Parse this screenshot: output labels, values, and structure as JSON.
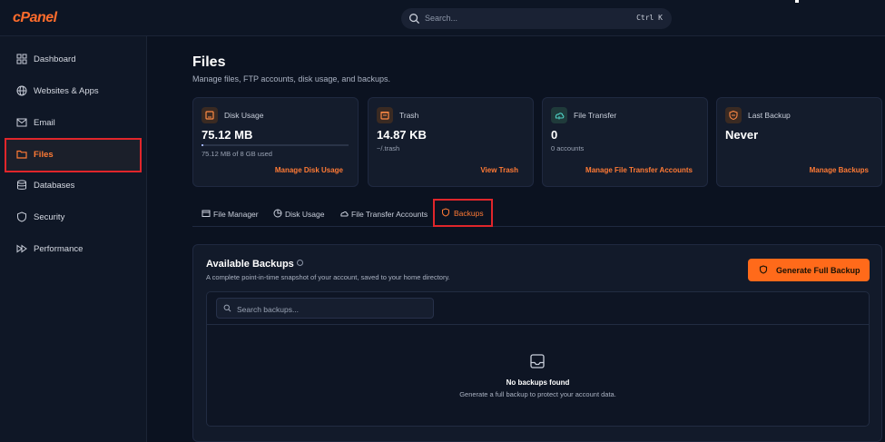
{
  "app": {
    "logo": "cPanel"
  },
  "search": {
    "placeholder": "Search...",
    "shortcut": "Ctrl K"
  },
  "sidebar": {
    "items": [
      {
        "label": "Dashboard",
        "icon": "dashboard-icon"
      },
      {
        "label": "Websites & Apps",
        "icon": "globe-icon"
      },
      {
        "label": "Email",
        "icon": "mail-icon"
      },
      {
        "label": "Files",
        "icon": "folder-icon",
        "active": true
      },
      {
        "label": "Databases",
        "icon": "database-icon"
      },
      {
        "label": "Security",
        "icon": "shield-icon"
      },
      {
        "label": "Performance",
        "icon": "fast-forward-icon"
      }
    ]
  },
  "page": {
    "title": "Files",
    "subtitle": "Manage files, FTP accounts, disk usage, and backups."
  },
  "cards": [
    {
      "label": "Disk Usage",
      "value": "75.12 MB",
      "note": "75.12 MB of 8 GB used",
      "link": "Manage Disk Usage",
      "usage_fraction": 0.009
    },
    {
      "label": "Trash",
      "value": "14.87 KB",
      "note": "~/.trash",
      "link": "View Trash"
    },
    {
      "label": "File Transfer",
      "value": "0",
      "note": "0 accounts",
      "link": "Manage File Transfer Accounts"
    },
    {
      "label": "Last Backup",
      "value": "Never",
      "note": "",
      "link": "Manage Backups"
    }
  ],
  "tabs": [
    {
      "label": "File Manager",
      "icon": "file-manager-icon"
    },
    {
      "label": "Disk Usage",
      "icon": "pie-chart-icon"
    },
    {
      "label": "File Transfer Accounts",
      "icon": "cloud-upload-icon"
    },
    {
      "label": "Backups",
      "icon": "backup-icon",
      "active": true
    }
  ],
  "backups": {
    "title": "Available Backups",
    "subtitle": "A complete point-in-time snapshot of your account, saved to your home directory.",
    "generate_label": "Generate Full Backup",
    "search_placeholder": "Search backups...",
    "empty_title": "No backups found",
    "empty_subtitle": "Generate a full backup to protect your account data."
  },
  "colors": {
    "accent": "#ff6a1a",
    "highlight_border": "#e0262b",
    "background": "#0b1220"
  }
}
